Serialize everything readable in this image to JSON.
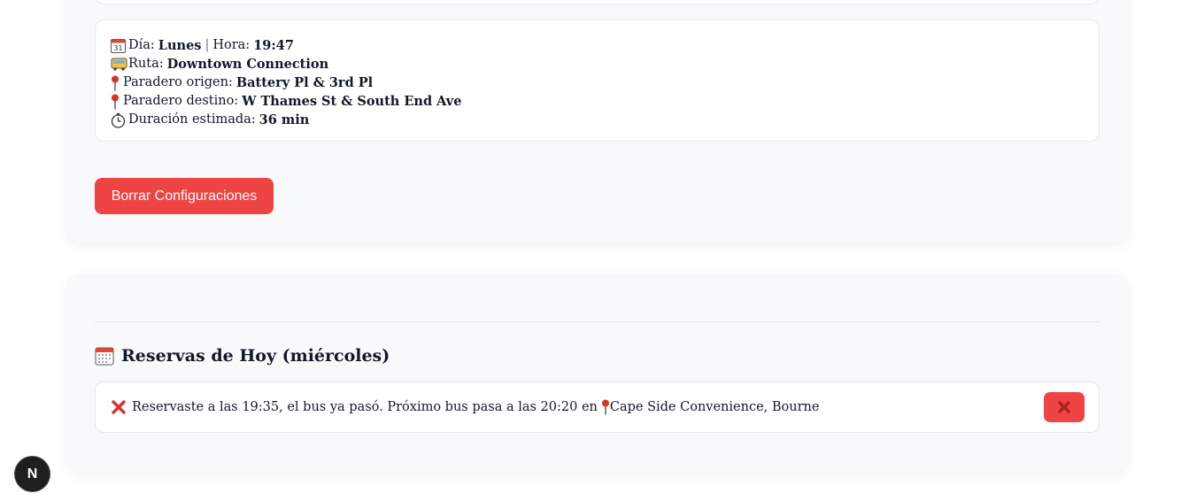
{
  "summary": {
    "dia_label": "Día:",
    "dia_value": "Lunes",
    "separator": "|",
    "hora_label": "Hora:",
    "hora_value": "19:47",
    "ruta_label": "Ruta:",
    "ruta_value": "Downtown Connection",
    "origen_label": "Paradero origen:",
    "origen_value": "Battery Pl & 3rd Pl",
    "destino_label": "Paradero destino:",
    "destino_value": "W Thames St & South End Ave",
    "duracion_label": "Duración estimada:",
    "duracion_value": "36 min"
  },
  "actions": {
    "clear_label": "Borrar Configuraciones"
  },
  "reservas": {
    "title": "Reservas de Hoy (miércoles)",
    "items": [
      {
        "message": "Reservaste a las 19:35, el bus ya pasó. Próximo bus pasa a las 20:20 en",
        "stop": "Cape Side Convenience, Bourne"
      }
    ]
  },
  "badge": {
    "letter": "N"
  },
  "icons": {
    "calendar": "calendar-icon",
    "bus": "bus-icon",
    "pin": "pin-icon",
    "stopwatch": "stopwatch-icon",
    "cross": "cross-mark-icon"
  },
  "colors": {
    "danger": "#ef4444",
    "card_bg": "#f8f9fb",
    "text": "#111827"
  }
}
